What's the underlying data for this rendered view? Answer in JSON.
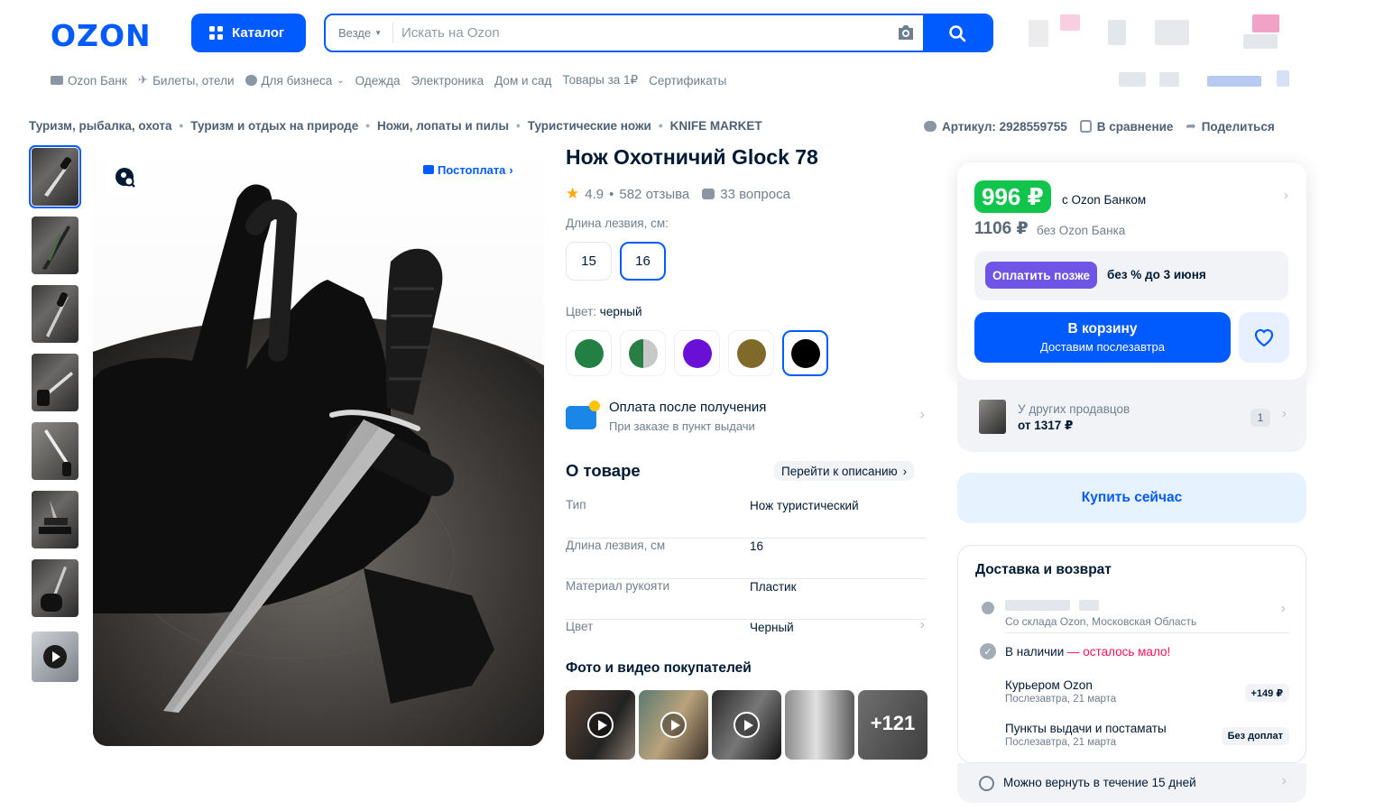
{
  "header": {
    "logo": "OZON",
    "catalog_label": "Каталог",
    "search_scope": "Везде",
    "search_placeholder": "Искать на Ozon"
  },
  "nav": [
    "Ozon Банк",
    "Билеты, отели",
    "Для бизнеса",
    "Одежда",
    "Электроника",
    "Дом и сад",
    "Товары за 1₽",
    "Сертификаты"
  ],
  "breadcrumbs": [
    "Туризм, рыбалка, охота",
    "Туризм и отдых на природе",
    "Ножи, лопаты и пилы",
    "Туристические ножи",
    "KNIFE MARKET"
  ],
  "meta": {
    "article": "Артикул: 2928559755",
    "compare": "В сравнение",
    "share": "Поделиться"
  },
  "gallery": {
    "postpay_label": "Постоплата"
  },
  "product": {
    "title": "Нож Охотничий Glock 78",
    "rating": "4.9",
    "reviews": "582 отзыва",
    "questions": "33 вопроса",
    "blade_label": "Длина лезвия, см:",
    "sizes": [
      "15",
      "16"
    ],
    "color_label": "Цвет:",
    "color_value": "черный",
    "colors": [
      "#238044",
      "split",
      "#6a0fd6",
      "#7f6a2a",
      "#000000"
    ],
    "payment_title": "Оплата после получения",
    "payment_sub": "При заказе в пункт выдачи",
    "about_title": "О товаре",
    "about_link": "Перейти к описанию",
    "attributes": [
      {
        "k": "Тип",
        "v": "Нож туристический"
      },
      {
        "k": "Длина лезвия, см",
        "v": "16"
      },
      {
        "k": "Материал рукояти",
        "v": "Пластик"
      },
      {
        "k": "Цвет",
        "v": "Черный"
      }
    ],
    "photos_title": "Фото и видео покупателей",
    "photos_more": "+121"
  },
  "price": {
    "card_price": "996 ₽",
    "card_label": "с Ozon Банком",
    "regular_price": "1106 ₽",
    "regular_label": "без Ozon Банка",
    "paylater_badge": "Оплатить позже",
    "paylater_text": "без % до 3 июня",
    "cart_title": "В корзину",
    "cart_sub": "Доставим послезавтра"
  },
  "other_sellers": {
    "label": "У других продавцов",
    "price": "от 1317 ₽",
    "count": "1"
  },
  "buy_now": "Купить сейчас",
  "delivery": {
    "title": "Доставка и возврат",
    "warehouse": "Со склада Ozon, Московская Область",
    "stock": "В наличии",
    "stock_warn": "— осталось мало!",
    "courier": "Курьером Ozon",
    "courier_date": "Послезавтра, 21 марта",
    "courier_price": "+149 ₽",
    "pickup": "Пункты выдачи и постаматы",
    "pickup_date": "Послезавтра, 21 марта",
    "pickup_price": "Без доплат",
    "return": "Можно вернуть в течение 15 дней"
  }
}
